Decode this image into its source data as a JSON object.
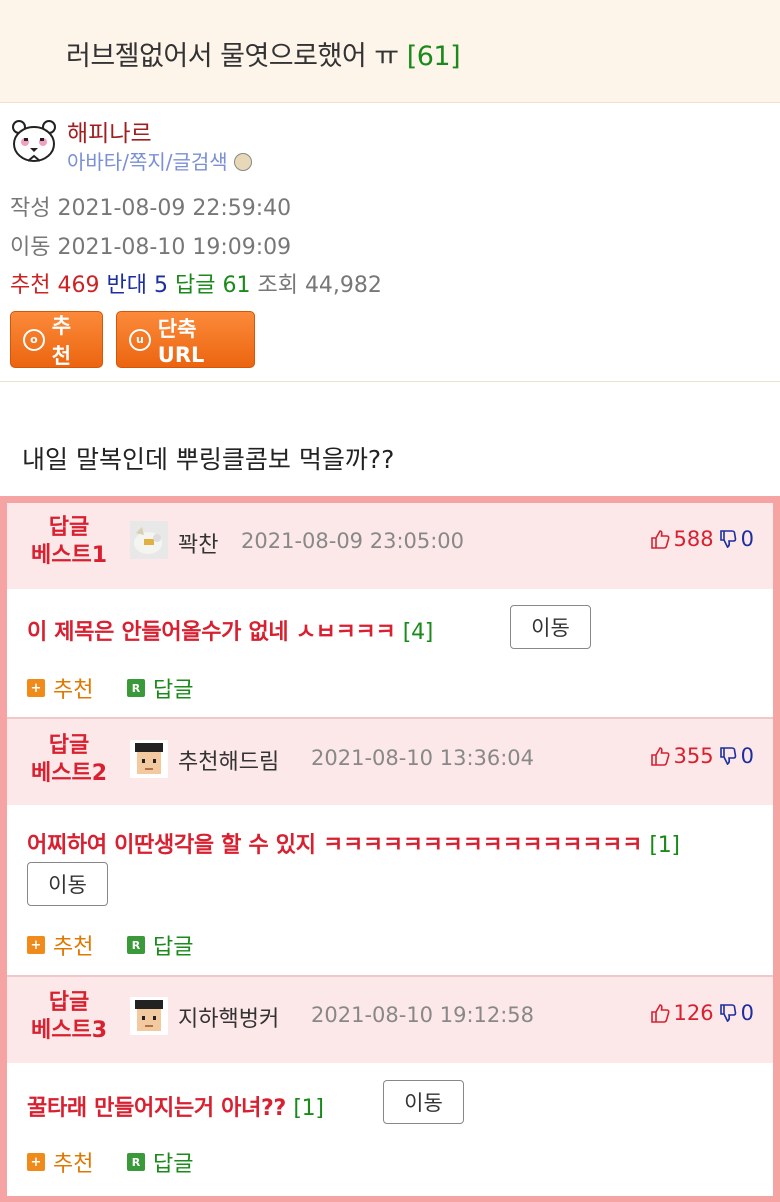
{
  "post": {
    "title": "러브젤없어서 물엿으로했어 ㅠ",
    "reply_count_label": "[61]",
    "author": "해피나르",
    "author_links": "아바타/쪽지/글검색",
    "written_label": "작성",
    "written": "2021-08-09 22:59:40",
    "moved_label": "이동",
    "moved": "2021-08-10 19:09:09",
    "stats": {
      "rec_label": "추천",
      "rec": "469",
      "opp_label": "반대",
      "opp": "5",
      "reply_label": "답글",
      "reply": "61",
      "view_label": "조회",
      "view": "44,982"
    },
    "buttons": {
      "recommend": "추천",
      "short_url": "단축URL",
      "recommend_icon": "ⓞ",
      "url_icon": "ⓤ"
    },
    "body": "내일 말복인데 뿌링클콤보 먹을까??"
  },
  "best_comments": [
    {
      "label_line1": "답글",
      "label_line2": "베스트1",
      "nick": "꽉찬",
      "date": "2021-08-09 23:05:00",
      "up": "588",
      "down": "0",
      "text": "이 제목은 안들어올수가 없네 ㅅㅂㅋㅋㅋ",
      "reply_count": "[4]",
      "move": "이동",
      "rec": "추천",
      "reply": "답글",
      "avatar_icon": "cat-avatar-icon"
    },
    {
      "label_line1": "답글",
      "label_line2": "베스트2",
      "nick": "추천해드림",
      "date": "2021-08-10 13:36:04",
      "up": "355",
      "down": "0",
      "text": "어찌하여 이딴생각을 할 수 있지 ㅋㅋㅋㅋㅋㅋㅋㅋㅋㅋㅋㅋㅋㅋㅋㅋ",
      "reply_count": "[1]",
      "move": "이동",
      "rec": "추천",
      "reply": "답글",
      "avatar_icon": "pixel-face-avatar-icon"
    },
    {
      "label_line1": "답글",
      "label_line2": "베스트3",
      "nick": "지하핵벙커",
      "date": "2021-08-10 19:12:58",
      "up": "126",
      "down": "0",
      "text": "꿀타래 만들어지는거 아녀??",
      "reply_count": "[1]",
      "move": "이동",
      "rec": "추천",
      "reply": "답글",
      "avatar_icon": "pixel-face-avatar-icon"
    }
  ],
  "colors": {
    "accent_orange": "#ec6510",
    "best_red": "#d82030",
    "reply_green": "#1a8a1a",
    "frame_pink": "#f5a3a3"
  }
}
